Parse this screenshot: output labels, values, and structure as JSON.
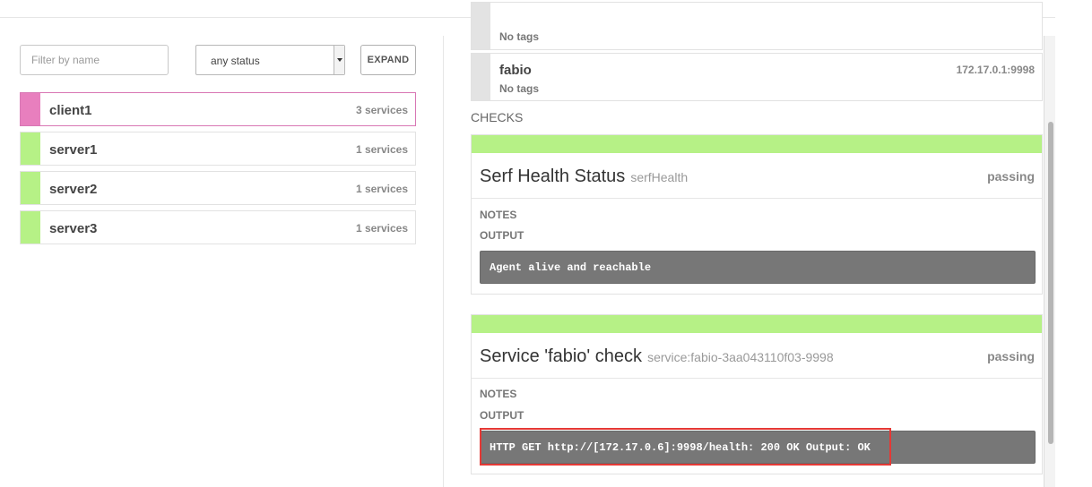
{
  "filters": {
    "name_placeholder": "Filter by name",
    "status_value": "any status",
    "expand_label": "EXPAND"
  },
  "nodes": [
    {
      "name": "client1",
      "count": "3 services",
      "color": "#e87fbe",
      "selected": true
    },
    {
      "name": "server1",
      "count": "1 services",
      "color": "#b6f186",
      "selected": false
    },
    {
      "name": "server2",
      "count": "1 services",
      "color": "#b6f186",
      "selected": false
    },
    {
      "name": "server3",
      "count": "1 services",
      "color": "#b6f186",
      "selected": false
    }
  ],
  "services": [
    {
      "name": "",
      "tags": "No tags",
      "address": ""
    },
    {
      "name": "fabio",
      "tags": "No tags",
      "address": "172.17.0.1:9998"
    }
  ],
  "checks_heading": "CHECKS",
  "checks": [
    {
      "title": "Serf Health Status",
      "id": "serfHealth",
      "state": "passing",
      "notes_label": "NOTES",
      "output_label": "OUTPUT",
      "output": "Agent alive and reachable",
      "color": "#b6f186"
    },
    {
      "title": "Service 'fabio' check",
      "id": "service:fabio-3aa043110f03-9998",
      "state": "passing",
      "notes_label": "NOTES",
      "output_label": "OUTPUT",
      "output": "HTTP GET http://[172.17.0.6]:9998/health: 200 OK Output: OK",
      "color": "#b6f186"
    }
  ]
}
